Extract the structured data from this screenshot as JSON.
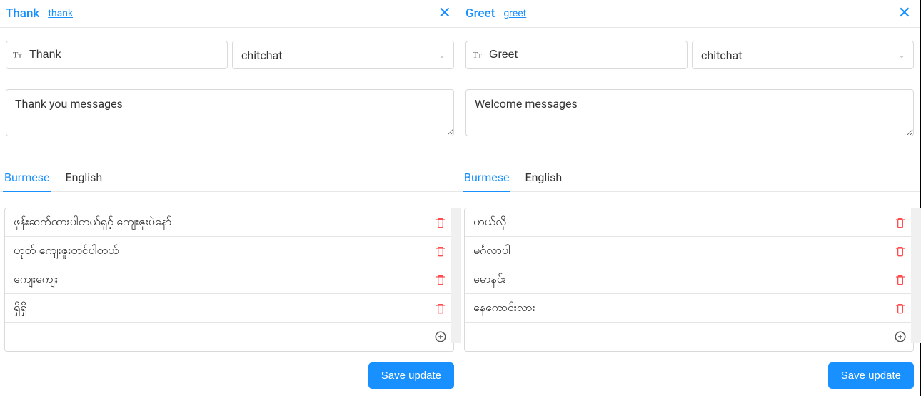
{
  "panels": [
    {
      "title": "Thank",
      "slug": "thank",
      "name_value": "Thank",
      "category": "chitchat",
      "description": "Thank you messages",
      "tabs": {
        "burmese": "Burmese",
        "english": "English"
      },
      "items": [
        "ဖုန်းဆက်ထားပါတယ်ရှင့် ကျေးဇူးပဲနော်",
        "ဟုတ် ကျေးဇူးတင်ပါတယ်",
        "ကျေးကျေး",
        "ရှိရှိ"
      ],
      "new_item_placeholder": "",
      "save_label": "Save update"
    },
    {
      "title": "Greet",
      "slug": "greet",
      "name_value": "Greet",
      "category": "chitchat",
      "description": "Welcome messages",
      "tabs": {
        "burmese": "Burmese",
        "english": "English"
      },
      "items": [
        "ဟယ်လို",
        "မင်္ဂလာပါ",
        "မောနင်း",
        "နေကောင်းလား"
      ],
      "new_item_placeholder": "",
      "save_label": "Save update"
    }
  ]
}
